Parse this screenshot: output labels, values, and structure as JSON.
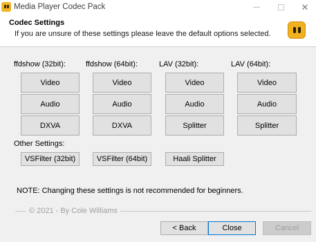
{
  "window": {
    "title": "Media Player Codec Pack",
    "minimize_glyph": "—",
    "close_glyph": "✕"
  },
  "header": {
    "title": "Codec Settings",
    "subtitle": "If you are unsure of these settings please leave the default options selected."
  },
  "columns": [
    {
      "label": "ffdshow (32bit):",
      "buttons": [
        "Video",
        "Audio",
        "DXVA"
      ]
    },
    {
      "label": "ffdshow (64bit):",
      "buttons": [
        "Video",
        "Audio",
        "DXVA"
      ]
    },
    {
      "label": "LAV (32bit):",
      "buttons": [
        "Video",
        "Audio",
        "Splitter"
      ]
    },
    {
      "label": "LAV (64bit):",
      "buttons": [
        "Video",
        "Audio",
        "Splitter"
      ]
    }
  ],
  "other_settings": {
    "label": "Other Settings:",
    "buttons": [
      "VSFilter (32bit)",
      "VSFilter (64bit)",
      "Haali Splitter"
    ]
  },
  "note": "NOTE: Changing these settings is not recommended for beginners.",
  "copyright": "© 2021 - By Cole Williams",
  "footer": {
    "back_label": "< Back",
    "close_label": "Close",
    "cancel_label": "Cancel",
    "cancel_enabled": false
  }
}
